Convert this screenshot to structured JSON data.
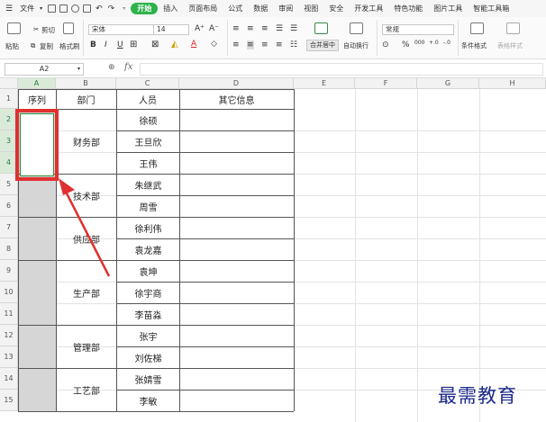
{
  "menubar": {
    "file": "文件",
    "tabs": [
      "开始",
      "插入",
      "页面布局",
      "公式",
      "数据",
      "审阅",
      "视图",
      "安全",
      "开发工具",
      "特色功能",
      "图片工具",
      "智能工具箱"
    ]
  },
  "toolbar": {
    "paste": "粘贴",
    "cut": "剪切",
    "copy": "复制",
    "format_painter": "格式刷",
    "font_name": "宋体",
    "font_size": "14",
    "merge_center": "合并居中",
    "wrap_text": "自动换行",
    "number_format": "常规",
    "conditional_format": "条件格式",
    "table_style": "表格样式"
  },
  "formula_bar": {
    "cell_ref": "A2",
    "fx": "fx",
    "value": ""
  },
  "sheet": {
    "columns": [
      "A",
      "B",
      "C",
      "D",
      "E",
      "F",
      "G",
      "H"
    ],
    "rows": [
      "1",
      "2",
      "3",
      "4",
      "5",
      "6",
      "7",
      "8",
      "9",
      "10",
      "11",
      "12",
      "13",
      "14",
      "15"
    ],
    "selected_column": "A",
    "headers": [
      "序列",
      "部门",
      "人员",
      "其它信息"
    ],
    "departments": [
      "财务部",
      "技术部",
      "供应部",
      "生产部",
      "管理部",
      "工艺部"
    ],
    "people": [
      "徐硕",
      "王旦欣",
      "王伟",
      "朱继武",
      "周雪",
      "徐利伟",
      "袁龙嘉",
      "袁坤",
      "徐宇商",
      "李苗淼",
      "张宇",
      "刘佐梯",
      "张婧雪",
      "李敏"
    ]
  },
  "watermark": "最需教育",
  "colors": {
    "accent_green": "#2db34a",
    "highlight_red": "#e03030",
    "fill_grey": "#d6d6d6"
  }
}
